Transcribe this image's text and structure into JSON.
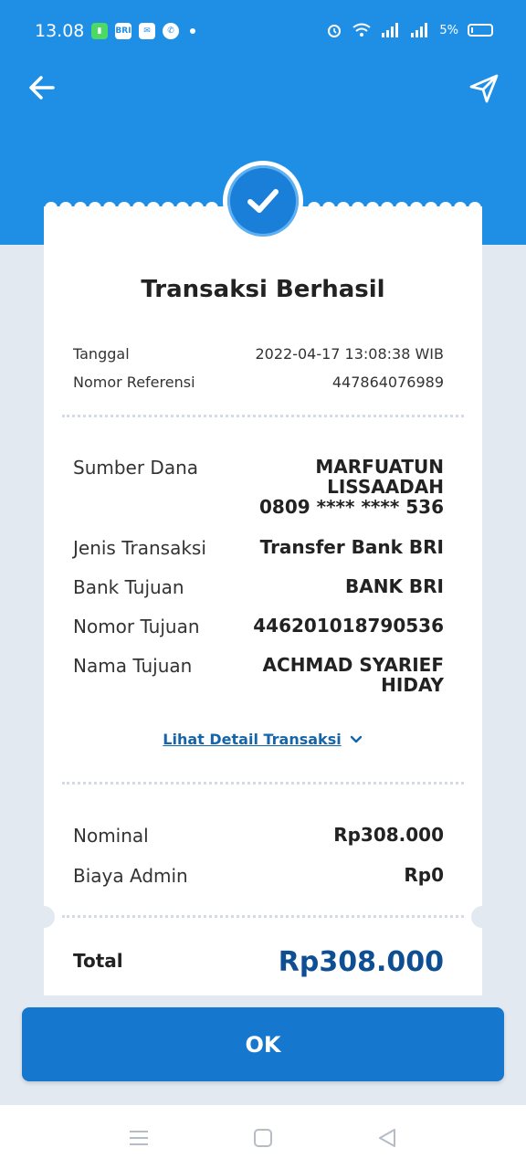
{
  "status_bar": {
    "time": "13.08",
    "battery": "5%",
    "icons_left": [
      "battery-saver-icon",
      "brimo-icon",
      "mail-icon",
      "whatsapp-icon"
    ],
    "icons_right": [
      "alarm-icon",
      "wifi-icon",
      "signal-icon",
      "signal-icon"
    ]
  },
  "header": {
    "back_icon": "arrow-left-icon",
    "share_icon": "send-icon"
  },
  "receipt": {
    "title": "Transaksi Berhasil",
    "tanggal_label": "Tanggal",
    "tanggal_value": "2022-04-17 13:08:38 WIB",
    "ref_label": "Nomor Referensi",
    "ref_value": "447864076989",
    "sumber_label": "Sumber Dana",
    "sumber_name_1": "MARFUATUN",
    "sumber_name_2": "LISSAADAH",
    "sumber_account": "0809 **** **** 536",
    "jenis_label": "Jenis Transaksi",
    "jenis_value": "Transfer Bank BRI",
    "bank_label": "Bank Tujuan",
    "bank_value": "BANK BRI",
    "nomor_label": "Nomor Tujuan",
    "nomor_value": "446201018790536",
    "nama_label": "Nama Tujuan",
    "nama_value_1": "ACHMAD SYARIEF",
    "nama_value_2": "HIDAY",
    "detail_link": "Lihat Detail Transaksi",
    "nominal_label": "Nominal",
    "nominal_value": "Rp308.000",
    "admin_label": "Biaya Admin",
    "admin_value": "Rp0",
    "total_label": "Total",
    "total_value": "Rp308.000"
  },
  "ok_button": "OK",
  "colors": {
    "header_blue": "#1f8fe6",
    "button_blue": "#1677cf",
    "total_blue": "#0e4f93",
    "link_blue": "#1565a8",
    "background": "#e3e9f1"
  }
}
